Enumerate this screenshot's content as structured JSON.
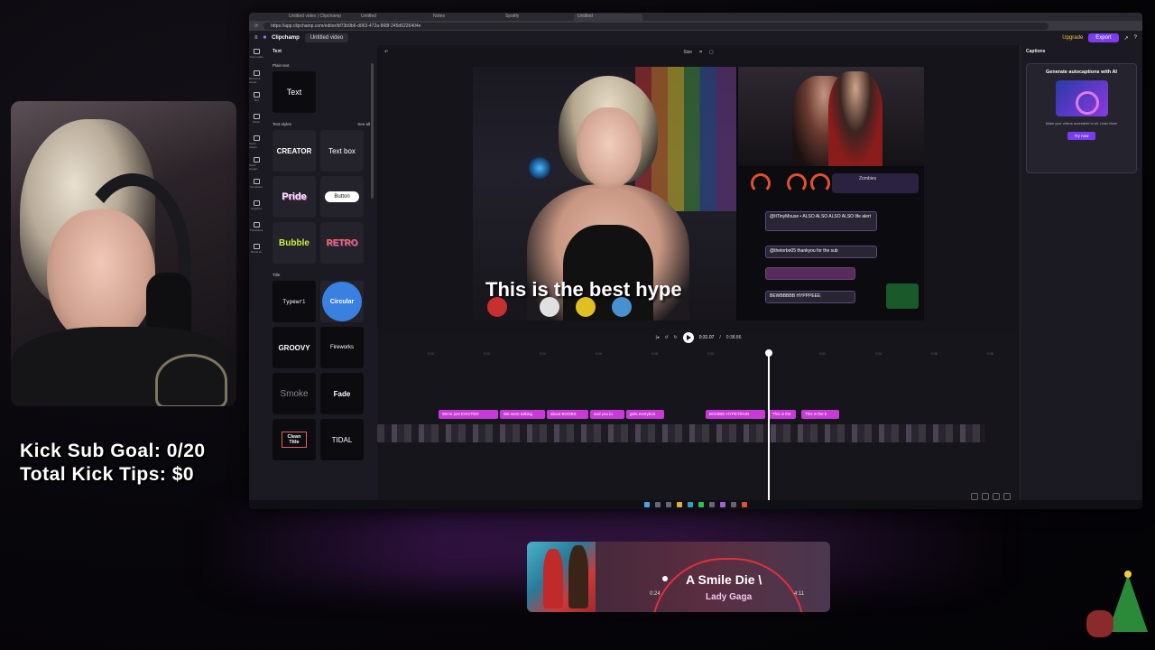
{
  "overlay": {
    "kick_sub_goal": "Kick Sub Goal: 0/20",
    "kick_tips": "Total Kick Tips: $0"
  },
  "browser": {
    "url": "https://app.clipchamp.com/editor/bf73b9b6-d063-472a-868f-245d6226404e",
    "tabs": [
      "Untitled video | Clipchamp",
      "Untitled",
      "Notes",
      "Spotify",
      "Untitled"
    ]
  },
  "app": {
    "brand": "Clipchamp",
    "video_title": "Untitled video",
    "upgrade_label": "Upgrade",
    "export_label": "Export"
  },
  "rail": [
    "Your media",
    "Record & create",
    "Text",
    "Music",
    "Stock videos",
    "Stock images",
    "Templates",
    "Graphics",
    "Transitions",
    "Brand kit"
  ],
  "text_panel": {
    "title": "Text",
    "plain_text_label": "Plain text",
    "plain_text_tile": "Text",
    "styles_label": "Text styles",
    "see_all": "See all",
    "styles": [
      "CREATOR",
      "Text box",
      "Pride",
      "Button",
      "Bubble",
      "RETRO"
    ],
    "title_label": "Title",
    "titles": [
      "Typewri",
      "Circular",
      "GROOVY",
      "Fireworks",
      "Smoke",
      "Fade",
      "Clean Title",
      "TIDAL"
    ]
  },
  "editor": {
    "size_label": "Size",
    "caption_text": "This is the best hype",
    "alerts": [
      "@ItTinyMouse • ALSO ALSO ALSO ALSO life alert",
      "@thetorbo05 thankyou for the sub",
      "",
      "BEWBBBBB HYPPPEEE"
    ],
    "zombies_label": "Zombies"
  },
  "timeline": {
    "current_time": "0:31.07",
    "total_time": "0:38.86",
    "ruler": [
      "0:20",
      "0:22",
      "0:24",
      "0:26",
      "0:28",
      "0:30",
      "0:32",
      "0:34",
      "0:36",
      "0:38"
    ],
    "caption_clips": [
      "We're just EXCITED",
      "We were talking",
      "about BOOBS",
      "and you lo",
      "gets everyboo",
      "BOOBIE HYPETRAIN",
      "This is the",
      "This is the b"
    ]
  },
  "captions_panel": {
    "title": "Captions",
    "card_heading": "Generate autocaptions with AI",
    "card_desc": "Make your videos accessible to all. Learn More",
    "try_label": "Try now"
  },
  "music": {
    "song": "A Smile   Die \\",
    "artist": "Lady Gaga",
    "elapsed": "0:24",
    "duration": "4:11",
    "progress": 0.1
  },
  "colors": {
    "accent": "#7b3cf0",
    "caption_clip": "#c83ad8",
    "progress_arc": "#e0303a"
  }
}
